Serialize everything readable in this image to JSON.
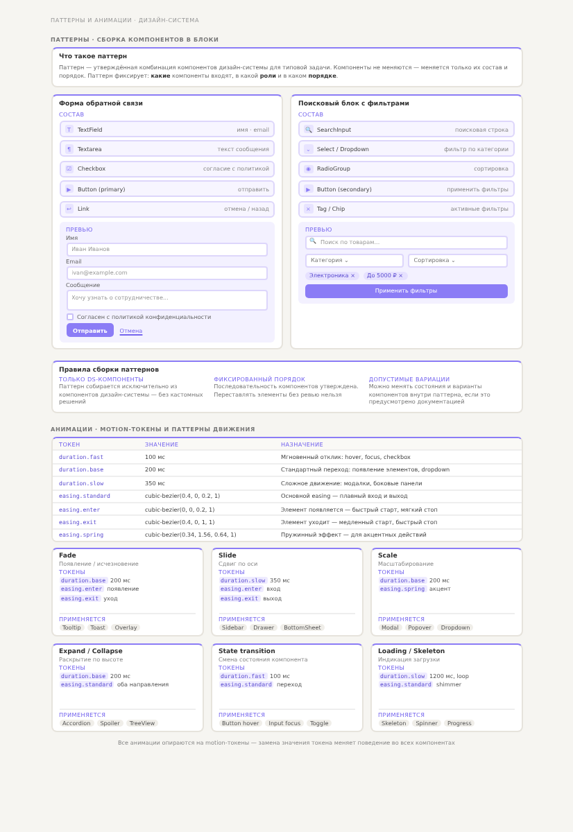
{
  "page_title": "ПАТТЕРНЫ И АНИМАЦИИ · ДИЗАЙН-СИСТЕМА",
  "patterns_section": {
    "heading": "ПАТТЕРНЫ · СБОРКА КОМПОНЕНТОВ В БЛОКИ",
    "intro": {
      "title": "Что такое паттерн",
      "text": "Паттерн — утверждённая комбинация компонентов дизайн-системы для типовой задачи. Компоненты не меняются — меняется только их состав и порядок. Паттерн фиксирует: **какие** компоненты входят, в какой **роли** и в каком **порядке**."
    },
    "patterns": [
      {
        "title": "Форма обратной связи",
        "composition_label": "СОСТАВ",
        "components": [
          {
            "icon": "T",
            "name": "TextField",
            "role": "имя · email"
          },
          {
            "icon": "¶",
            "name": "Textarea",
            "role": "текст сообщения"
          },
          {
            "icon": "☑",
            "name": "Checkbox",
            "role": "согласие с политикой"
          },
          {
            "icon": "▶",
            "name": "Button (primary)",
            "role": "отправить"
          },
          {
            "icon": "↩",
            "name": "Link",
            "role": "отмена / назад"
          }
        ],
        "preview": {
          "label": "ПРЕВЬЮ",
          "kind": "form",
          "fields": [
            {
              "label": "Имя",
              "placeholder": "Иван Иванов",
              "multiline": false
            },
            {
              "label": "Email",
              "placeholder": "ivan@example.com",
              "multiline": false
            },
            {
              "label": "Сообщение",
              "placeholder": "Хочу узнать о сотрудничестве...",
              "multiline": true
            }
          ],
          "consent": {
            "label": "Согласен с политикой конфиденциальности",
            "checked": false
          },
          "submit": "Отправить",
          "cancel": "Отмена"
        }
      },
      {
        "title": "Поисковый блок с фильтрами",
        "composition_label": "СОСТАВ",
        "components": [
          {
            "icon": "🔍",
            "name": "SearchInput",
            "role": "поисковая строка"
          },
          {
            "icon": "⌄",
            "name": "Select / Dropdown",
            "role": "фильтр по категории"
          },
          {
            "icon": "◉",
            "name": "RadioGroup",
            "role": "сортировка"
          },
          {
            "icon": "▶",
            "name": "Button (secondary)",
            "role": "применить фильтры"
          },
          {
            "icon": "×",
            "name": "Tag / Chip",
            "role": "активные фильтры"
          }
        ],
        "preview": {
          "label": "ПРЕВЬЮ",
          "kind": "search",
          "search_icon": "🔍",
          "search_placeholder": "Поиск по товарам...",
          "selects": [
            "Категория ⌄",
            "Сортировка ⌄"
          ],
          "chips": [
            "Электроника ×",
            "До 5000 ₽ ×"
          ],
          "apply": "Применить фильтры"
        }
      }
    ],
    "rules": {
      "title": "Правила сборки паттернов",
      "items": [
        {
          "heading": "ТОЛЬКО DS-КОМПОНЕНТЫ",
          "text": "Паттерн собирается исключительно из компонентов дизайн-системы — без кастомных решений"
        },
        {
          "heading": "ФИКСИРОВАННЫЙ ПОРЯДОК",
          "text": "Последовательность компонентов утверждена. Переставлять элементы без ревью нельзя"
        },
        {
          "heading": "ДОПУСТИМЫЕ ВАРИАЦИИ",
          "text": "Можно менять состояния и варианты компонентов внутри паттерна, если это предусмотрено документацией"
        }
      ]
    }
  },
  "animation_section": {
    "heading": "АНИМАЦИИ · MOTION-ТОКЕНЫ И ПАТТЕРНЫ ДВИЖЕНИЯ",
    "table": {
      "columns": [
        "ТОКЕН",
        "ЗНАЧЕНИЕ",
        "НАЗНАЧЕНИЕ"
      ],
      "rows": [
        [
          "duration.fast",
          "100 мс",
          "Мгновенный отклик: hover, focus, checkbox"
        ],
        [
          "duration.base",
          "200 мс",
          "Стандартный переход: появление элементов, dropdown"
        ],
        [
          "duration.slow",
          "350 мс",
          "Сложное движение: модалки, боковые панели"
        ],
        [
          "easing.standard",
          "cubic-bezier(0.4, 0, 0.2, 1)",
          "Основной easing — плавный вход и выход"
        ],
        [
          "easing.enter",
          "cubic-bezier(0, 0, 0.2, 1)",
          "Элемент появляется — быстрый старт, мягкий стоп"
        ],
        [
          "easing.exit",
          "cubic-bezier(0.4, 0, 1, 1)",
          "Элемент уходит — медленный старт, быстрый стоп"
        ],
        [
          "easing.spring",
          "cubic-bezier(0.34, 1.56, 0.64, 1)",
          "Пружинный эффект — для акцентных действий"
        ]
      ]
    },
    "motions": [
      {
        "title": "Fade",
        "subtitle": "Появление / исчезновение",
        "tokens_label": "ТОКЕНЫ",
        "tokens": [
          {
            "token": "duration.base",
            "note": "200 мс"
          },
          {
            "token": "easing.enter",
            "note": "появление"
          },
          {
            "token": "easing.exit",
            "note": "уход"
          }
        ],
        "usage_label": "ПРИМЕНЯЕТСЯ",
        "usage": [
          "Tooltip",
          "Toast",
          "Overlay"
        ]
      },
      {
        "title": "Slide",
        "subtitle": "Сдвиг по оси",
        "tokens_label": "ТОКЕНЫ",
        "tokens": [
          {
            "token": "duration.slow",
            "note": "350 мс"
          },
          {
            "token": "easing.enter",
            "note": "вход"
          },
          {
            "token": "easing.exit",
            "note": "выход"
          }
        ],
        "usage_label": "ПРИМЕНЯЕТСЯ",
        "usage": [
          "Sidebar",
          "Drawer",
          "BottomSheet"
        ]
      },
      {
        "title": "Scale",
        "subtitle": "Масштабирование",
        "tokens_label": "ТОКЕНЫ",
        "tokens": [
          {
            "token": "duration.base",
            "note": "200 мс"
          },
          {
            "token": "easing.spring",
            "note": "акцент"
          }
        ],
        "usage_label": "ПРИМЕНЯЕТСЯ",
        "usage": [
          "Modal",
          "Popover",
          "Dropdown"
        ]
      },
      {
        "title": "Expand / Collapse",
        "subtitle": "Раскрытие по высоте",
        "tokens_label": "ТОКЕНЫ",
        "tokens": [
          {
            "token": "duration.base",
            "note": "200 мс"
          },
          {
            "token": "easing.standard",
            "note": "оба направления"
          }
        ],
        "usage_label": "ПРИМЕНЯЕТСЯ",
        "usage": [
          "Accordion",
          "Spoiler",
          "TreeView"
        ]
      },
      {
        "title": "State transition",
        "subtitle": "Смена состояния компонента",
        "tokens_label": "ТОКЕНЫ",
        "tokens": [
          {
            "token": "duration.fast",
            "note": "100 мс"
          },
          {
            "token": "easing.standard",
            "note": "переход"
          }
        ],
        "usage_label": "ПРИМЕНЯЕТСЯ",
        "usage": [
          "Button hover",
          "Input focus",
          "Toggle"
        ]
      },
      {
        "title": "Loading / Skeleton",
        "subtitle": "Индикация загрузки",
        "tokens_label": "ТОКЕНЫ",
        "tokens": [
          {
            "token": "duration.slow",
            "note": "1200 мс, loop"
          },
          {
            "token": "easing.standard",
            "note": "shimmer"
          }
        ],
        "usage_label": "ПРИМЕНЯЕТСЯ",
        "usage": [
          "Skeleton",
          "Spinner",
          "Progress"
        ]
      }
    ],
    "footnote": "Все анимации опираются на motion-токены — замена значения токена меняет поведение во всех компонентах"
  }
}
